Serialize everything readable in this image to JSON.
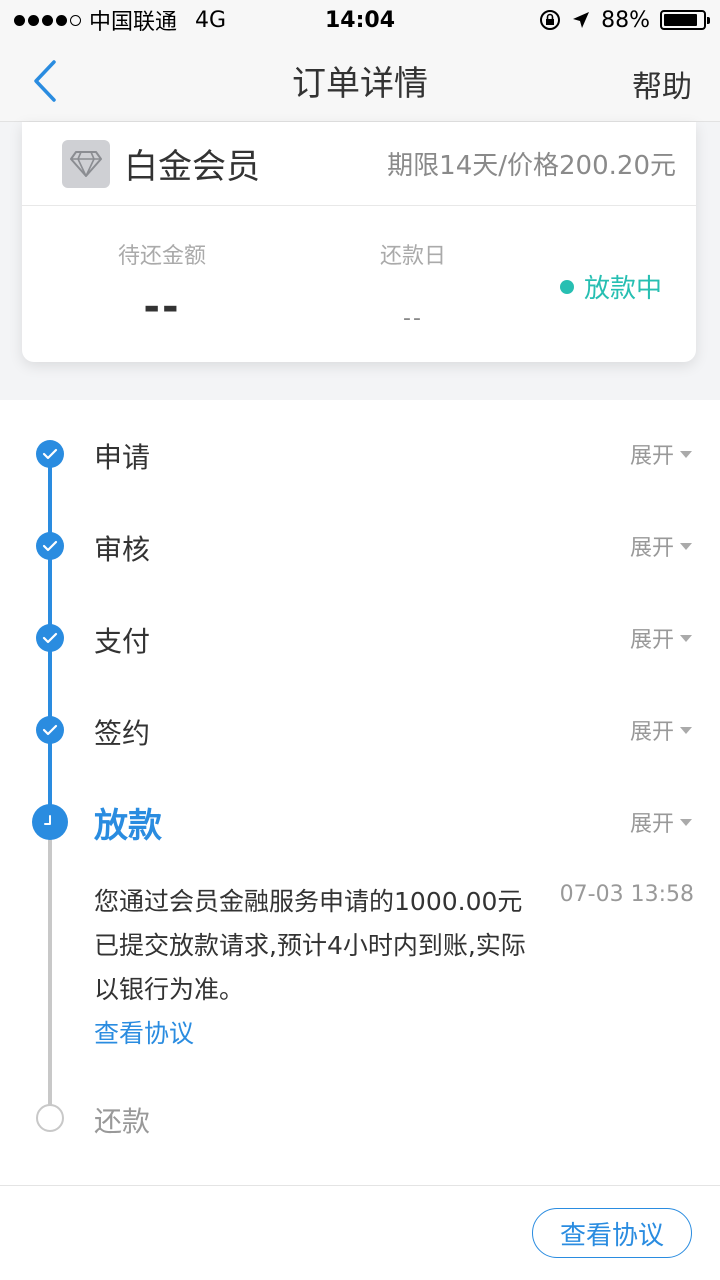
{
  "status_bar": {
    "carrier": "中国联通",
    "network": "4G",
    "time": "14:04",
    "battery": "88%",
    "battery_level": 0.88
  },
  "nav": {
    "title": "订单详情",
    "help": "帮助"
  },
  "card": {
    "member_name": "白金会员",
    "member_meta": "期限14天/价格200.20元",
    "stats": [
      {
        "label": "待还金额",
        "value": "--"
      },
      {
        "label": "还款日",
        "value": "--"
      }
    ],
    "status": "放款中",
    "status_color": "#27bfb2"
  },
  "timeline": {
    "expand_label": "展开",
    "steps": [
      {
        "label": "申请",
        "state": "done"
      },
      {
        "label": "审核",
        "state": "done"
      },
      {
        "label": "支付",
        "state": "done"
      },
      {
        "label": "签约",
        "state": "done"
      },
      {
        "label": "放款",
        "state": "active"
      },
      {
        "label": "还款",
        "state": "pending"
      }
    ],
    "detail_text": "您通过会员金融服务申请的1000.00元已提交放款请求,预计4小时内到账,实际以银行为准。",
    "detail_time": "07-03 13:58",
    "detail_link": "查看协议"
  },
  "bottom": {
    "button": "查看协议"
  },
  "colors": {
    "accent": "#2a8ce0",
    "pending": "#c8c8c8"
  },
  "icons": {
    "back": "chevron-left-icon",
    "badge": "diamond-icon",
    "check": "check-icon",
    "clock": "clock-icon"
  }
}
